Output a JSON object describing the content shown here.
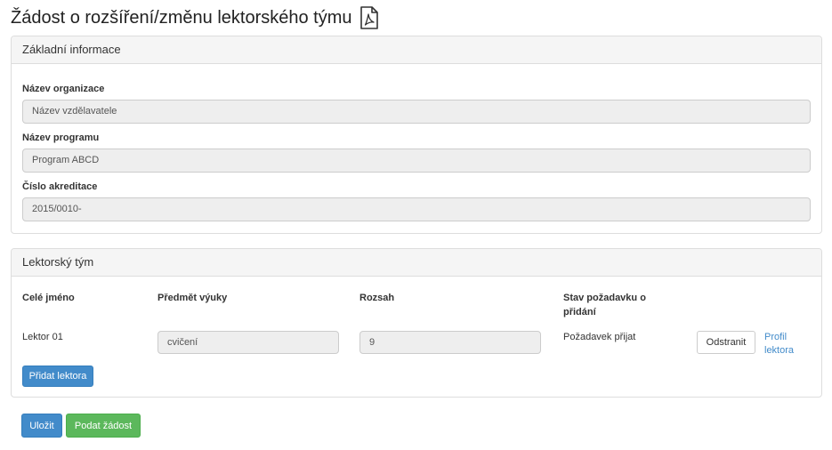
{
  "page": {
    "title": "Žádost o rozšíření/změnu lektorského týmu",
    "pdf_icon": "pdf-file-icon"
  },
  "basic_info": {
    "heading": "Základní informace",
    "organization_label": "Název organizace",
    "organization_value": "Název vzdělavatele",
    "program_label": "Název programu",
    "program_value": "Program ABCD",
    "accreditation_label": "Číslo akreditace",
    "accreditation_value": "2015/0010-"
  },
  "team": {
    "heading": "Lektorský tým",
    "columns": [
      "Celé jméno",
      "Předmět výuky",
      "Rozsah",
      "Stav požadavku o přidání"
    ],
    "rows": [
      {
        "name": "Lektor 01",
        "subject": "cvičení",
        "scope": "9",
        "status": "Požadavek přijat",
        "remove_label": "Odstranit",
        "profile_label": "Profil lektora"
      }
    ],
    "add_button": "Přidat lektora"
  },
  "actions": {
    "save": "Uložit",
    "submit": "Podat žádost"
  },
  "colors": {
    "primary": "#428bca",
    "success": "#5cb85c"
  }
}
